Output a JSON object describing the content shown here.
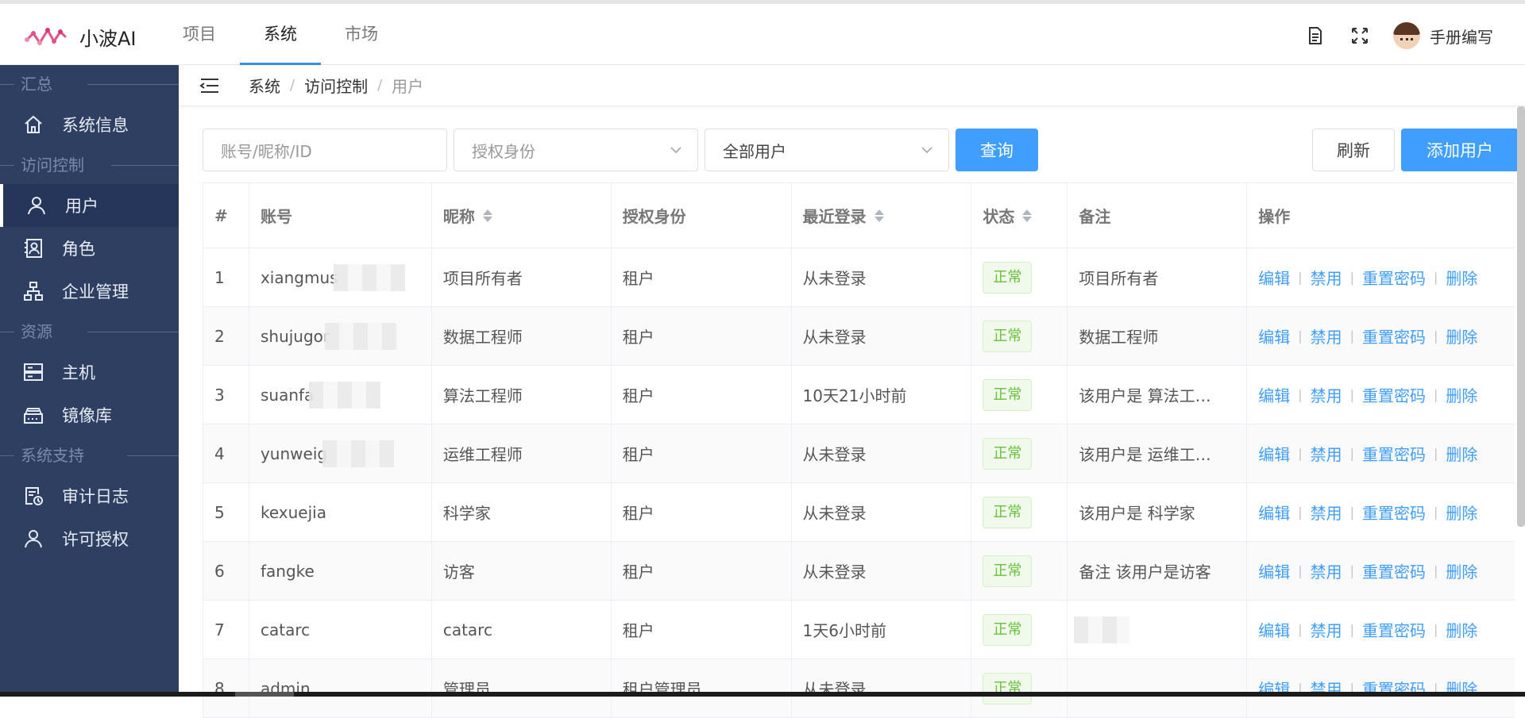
{
  "app": {
    "name": "小波AI"
  },
  "topnav": {
    "items": [
      {
        "label": "项目"
      },
      {
        "label": "系统"
      },
      {
        "label": "市场"
      }
    ],
    "active": 1
  },
  "topright": {
    "user_name": "手册编写",
    "icons": [
      "document-icon",
      "fullscreen-icon"
    ]
  },
  "sidebar": {
    "sections": [
      {
        "title": "汇总",
        "items": [
          {
            "label": "系统信息",
            "icon": "home-icon"
          }
        ]
      },
      {
        "title": "访问控制",
        "items": [
          {
            "label": "用户",
            "icon": "user-icon"
          },
          {
            "label": "角色",
            "icon": "role-icon"
          },
          {
            "label": "企业管理",
            "icon": "org-icon"
          }
        ]
      },
      {
        "title": "资源",
        "items": [
          {
            "label": "主机",
            "icon": "server-icon"
          },
          {
            "label": "镜像库",
            "icon": "registry-icon"
          }
        ]
      },
      {
        "title": "系统支持",
        "items": [
          {
            "label": "审计日志",
            "icon": "audit-log-icon"
          },
          {
            "label": "许可授权",
            "icon": "license-icon"
          }
        ]
      }
    ],
    "active": "用户"
  },
  "breadcrumb": {
    "items": [
      "系统",
      "访问控制",
      "用户"
    ]
  },
  "filters": {
    "search_placeholder": "账号/昵称/ID",
    "role_placeholder": "授权身份",
    "user_scope_value": "全部用户",
    "query_label": "查询",
    "refresh_label": "刷新",
    "add_label": "添加用户"
  },
  "table": {
    "headers": [
      "#",
      "账号",
      "昵称",
      "授权身份",
      "最近登录",
      "状态",
      "备注",
      "操作"
    ],
    "actions": [
      "编辑",
      "禁用",
      "重置密码",
      "删除"
    ],
    "rows": [
      {
        "idx": "1",
        "account": "xiangmus",
        "nickname": "项目所有者",
        "role": "租户",
        "last_login": "从未登录",
        "status": "正常",
        "remark": "项目所有者"
      },
      {
        "idx": "2",
        "account": "shujugor",
        "nickname": "数据工程师",
        "role": "租户",
        "last_login": "从未登录",
        "status": "正常",
        "remark": "数据工程师"
      },
      {
        "idx": "3",
        "account": "suanfa",
        "nickname": "算法工程师",
        "role": "租户",
        "last_login": "10天21小时前",
        "status": "正常",
        "remark": "该用户是 算法工…"
      },
      {
        "idx": "4",
        "account": "yunweig",
        "nickname": "运维工程师",
        "role": "租户",
        "last_login": "从未登录",
        "status": "正常",
        "remark": "该用户是 运维工…"
      },
      {
        "idx": "5",
        "account": "kexuejia",
        "nickname": "科学家",
        "role": "租户",
        "last_login": "从未登录",
        "status": "正常",
        "remark": "该用户是 科学家"
      },
      {
        "idx": "6",
        "account": "fangke",
        "nickname": "访客",
        "role": "租户",
        "last_login": "从未登录",
        "status": "正常",
        "remark": "备注 该用户是访客"
      },
      {
        "idx": "7",
        "account": "catarc",
        "nickname": "catarc",
        "role": "租户",
        "last_login": "1天6小时前",
        "status": "正常",
        "remark": ""
      },
      {
        "idx": "8",
        "account": "admin",
        "nickname": "管理员",
        "role": "租户管理员",
        "last_login": "从未登录",
        "status": "正常",
        "remark": ""
      }
    ]
  },
  "colors": {
    "primary": "#409eff",
    "sidebar_bg": "#2e3f62",
    "success": "#67c23a"
  }
}
